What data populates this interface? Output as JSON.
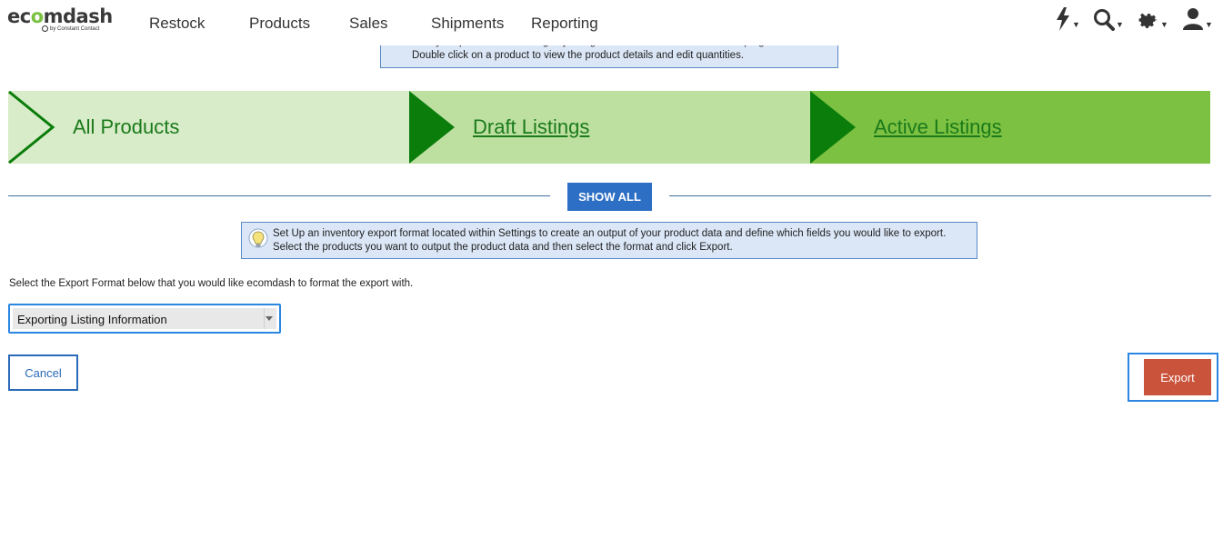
{
  "logo": {
    "text_pre": "ec",
    "text_o": "o",
    "text_post": "mdash",
    "sub": "by Constant Contact"
  },
  "nav": [
    {
      "label": "Restock"
    },
    {
      "label": "Products"
    },
    {
      "label": "Sales"
    },
    {
      "label": "Shipments"
    },
    {
      "label": "Reporting"
    }
  ],
  "nav_icons": [
    "lightning-icon",
    "search-icon",
    "gear-icon",
    "user-icon"
  ],
  "info_top": {
    "line1": "Turn your products into listings by using the Create Draft action in the top right.",
    "line2": "Double click on a product to view the product details and edit quantities."
  },
  "steps": [
    {
      "label": "All Products"
    },
    {
      "label": "Draft Listings"
    },
    {
      "label": "Active Listings"
    }
  ],
  "show_all_label": "SHOW ALL",
  "info_mid": {
    "line1": "Set Up an inventory export format located within Settings to create an output of your product data and define which fields you would like to export.",
    "line2": "Select the products you want to output the product data and then select the format and click Export."
  },
  "instruction": "Select the Export Format below that you would like ecomdash to format the export with.",
  "export_format": {
    "selected": "Exporting Listing Information"
  },
  "cancel_label": "Cancel",
  "export_label": "Export",
  "colors": {
    "step1": "#d8ecc9",
    "step2": "#bde0a1",
    "step3": "#7dc142",
    "arrow": "#0a7d0a",
    "primary": "#2d6fc4",
    "export": "#c9533b"
  }
}
